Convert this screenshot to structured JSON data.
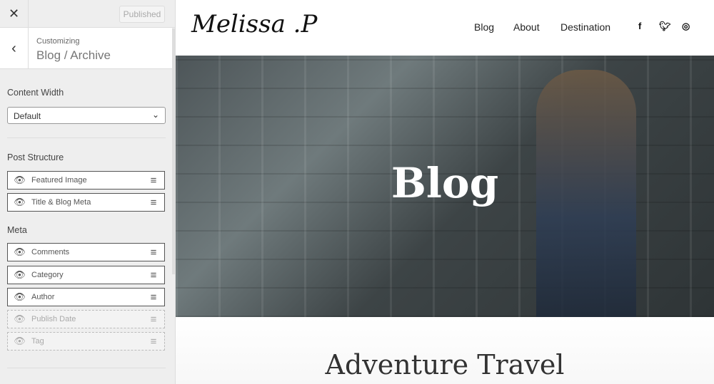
{
  "sidebar": {
    "close_icon": "close-icon",
    "published": "Published",
    "customizing": "Customizing",
    "title": "Blog / Archive",
    "content_width_label": "Content Width",
    "content_width_value": "Default",
    "post_structure_label": "Post Structure",
    "post_structure": [
      {
        "label": "Featured Image",
        "visible": true
      },
      {
        "label": "Title & Blog Meta",
        "visible": true
      }
    ],
    "meta_label": "Meta",
    "meta": [
      {
        "label": "Comments",
        "visible": true
      },
      {
        "label": "Category",
        "visible": true
      },
      {
        "label": "Author",
        "visible": true
      },
      {
        "label": "Publish Date",
        "visible": false
      },
      {
        "label": "Tag",
        "visible": false
      }
    ]
  },
  "preview": {
    "logo": "Melissa .P",
    "nav": [
      "Blog",
      "About",
      "Destination"
    ],
    "social": [
      "facebook-icon",
      "twitter-icon",
      "instagram-icon"
    ],
    "hero_title": "Blog",
    "post_title": "Adventure Travel"
  }
}
